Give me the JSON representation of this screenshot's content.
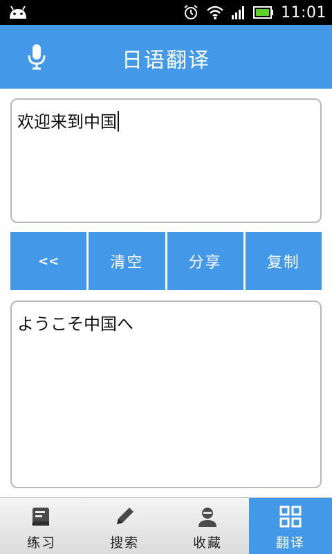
{
  "status_bar": {
    "time": "11:01",
    "icons": [
      "android-icon",
      "alarm-icon",
      "wifi-icon",
      "signal-icon",
      "battery-icon"
    ]
  },
  "header": {
    "title": "日语翻译",
    "mic_icon": "microphone-icon",
    "color": "#4498e8"
  },
  "input": {
    "value": "欢迎来到中国"
  },
  "buttons": {
    "back_label": "<<",
    "clear_label": "清空",
    "share_label": "分享",
    "copy_label": "复制"
  },
  "output": {
    "value": "ようこそ中国へ"
  },
  "bottom_nav": {
    "items": [
      {
        "label": "练习",
        "icon": "practice-icon"
      },
      {
        "label": "搜索",
        "icon": "pencil-icon"
      },
      {
        "label": "收藏",
        "icon": "user-icon"
      },
      {
        "label": "翻译",
        "icon": "grid-icon"
      }
    ],
    "active_index": 3
  }
}
